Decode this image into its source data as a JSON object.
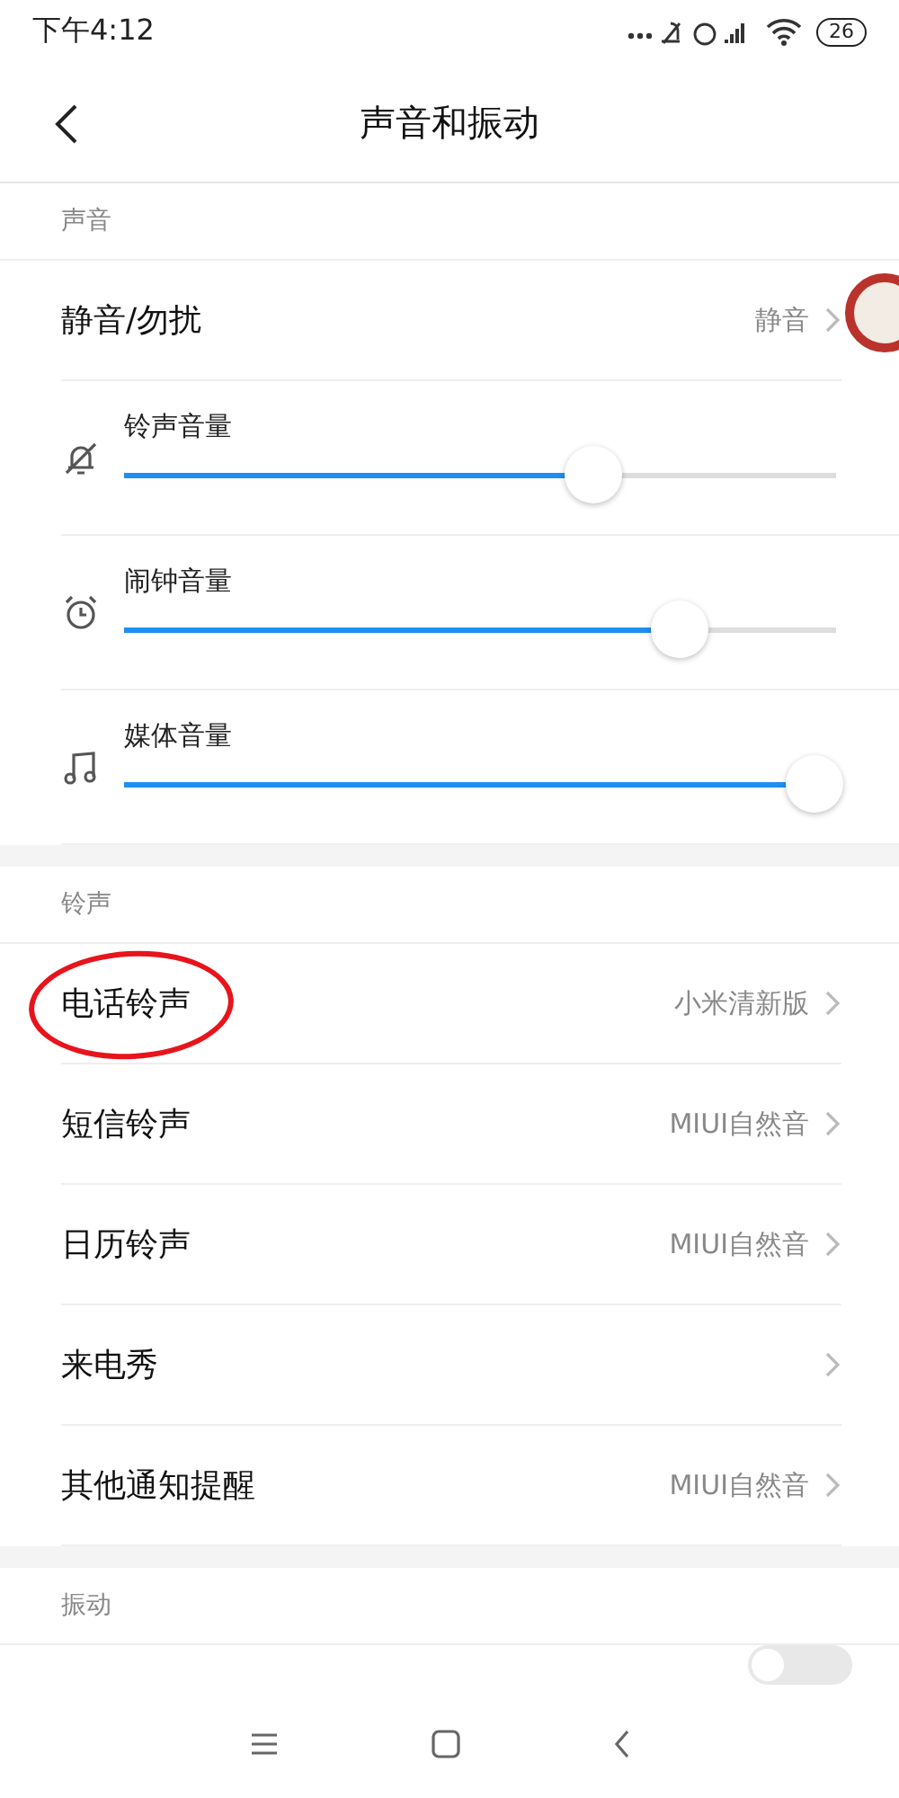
{
  "status_bar": {
    "time": "下午4:12",
    "battery": "26"
  },
  "header": {
    "title": "声音和振动"
  },
  "sections": [
    {
      "title": "声音",
      "items": [
        {
          "kind": "link",
          "label": "静音/勿扰",
          "value": "静音"
        },
        {
          "kind": "slider",
          "label": "铃声音量",
          "level": 0.66
        },
        {
          "kind": "slider",
          "label": "闹钟音量",
          "level": 0.78
        },
        {
          "kind": "slider",
          "label": "媒体音量",
          "level": 0.97
        }
      ]
    },
    {
      "title": "铃声",
      "items": [
        {
          "kind": "link",
          "label": "电话铃声",
          "value": "小米清新版",
          "circled": true
        },
        {
          "kind": "link",
          "label": "短信铃声",
          "value": "MIUI自然音"
        },
        {
          "kind": "link",
          "label": "日历铃声",
          "value": "MIUI自然音"
        },
        {
          "kind": "link",
          "label": "来电秀"
        },
        {
          "kind": "link",
          "label": "其他通知提醒",
          "value": "MIUI自然音"
        }
      ]
    },
    {
      "title": "振动",
      "items": [
        {
          "kind": "toggle",
          "on": false
        }
      ]
    }
  ]
}
